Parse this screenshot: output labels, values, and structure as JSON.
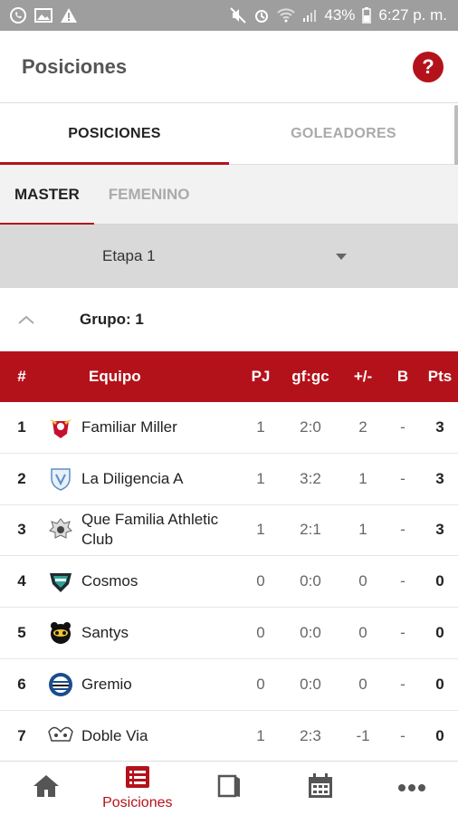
{
  "status_bar": {
    "left_icons": [
      "whatsapp-icon",
      "image-icon",
      "warning-icon"
    ],
    "right_icons": [
      "mute-icon",
      "alarm-icon",
      "wifi-icon",
      "signal-icon"
    ],
    "battery": "43%",
    "time": "6:27 p. m."
  },
  "appbar": {
    "title": "Posiciones",
    "help_label": "?"
  },
  "tabs": [
    {
      "label": "POSICIONES",
      "active": true
    },
    {
      "label": "GOLEADORES",
      "active": false
    }
  ],
  "subtabs": [
    {
      "label": "MASTER",
      "active": true
    },
    {
      "label": "FEMENINO",
      "active": false
    }
  ],
  "stage": {
    "selected": "Etapa 1"
  },
  "group": {
    "label": "Grupo: 1"
  },
  "table": {
    "headers": {
      "rank": "#",
      "team": "Equipo",
      "pj": "PJ",
      "gfgc": "gf:gc",
      "diff": "+/-",
      "b": "B",
      "pts": "Pts"
    },
    "rows": [
      {
        "rank": "1",
        "team": "Familiar Miller",
        "pj": "1",
        "gfgc": "2:0",
        "diff": "2",
        "b": "-",
        "pts": "3"
      },
      {
        "rank": "2",
        "team": "La Diligencia A",
        "pj": "1",
        "gfgc": "3:2",
        "diff": "1",
        "b": "-",
        "pts": "3"
      },
      {
        "rank": "3",
        "team": "Que Familia Athletic Club",
        "pj": "1",
        "gfgc": "2:1",
        "diff": "1",
        "b": "-",
        "pts": "3"
      },
      {
        "rank": "4",
        "team": "Cosmos",
        "pj": "0",
        "gfgc": "0:0",
        "diff": "0",
        "b": "-",
        "pts": "0"
      },
      {
        "rank": "5",
        "team": "Santys",
        "pj": "0",
        "gfgc": "0:0",
        "diff": "0",
        "b": "-",
        "pts": "0"
      },
      {
        "rank": "6",
        "team": "Gremio",
        "pj": "0",
        "gfgc": "0:0",
        "diff": "0",
        "b": "-",
        "pts": "0"
      },
      {
        "rank": "7",
        "team": "Doble Via",
        "pj": "1",
        "gfgc": "2:3",
        "diff": "-1",
        "b": "-",
        "pts": "0"
      }
    ]
  },
  "bottom_nav": [
    {
      "icon": "home-icon",
      "label": ""
    },
    {
      "icon": "list-icon",
      "label": "Posiciones",
      "active": true
    },
    {
      "icon": "book-icon",
      "label": ""
    },
    {
      "icon": "calendar-icon",
      "label": ""
    },
    {
      "icon": "more-icon",
      "label": ""
    }
  ],
  "colors": {
    "accent": "#b4121b",
    "status_bar": "#9e9e9e",
    "stage_bg": "#d9d9d9"
  }
}
